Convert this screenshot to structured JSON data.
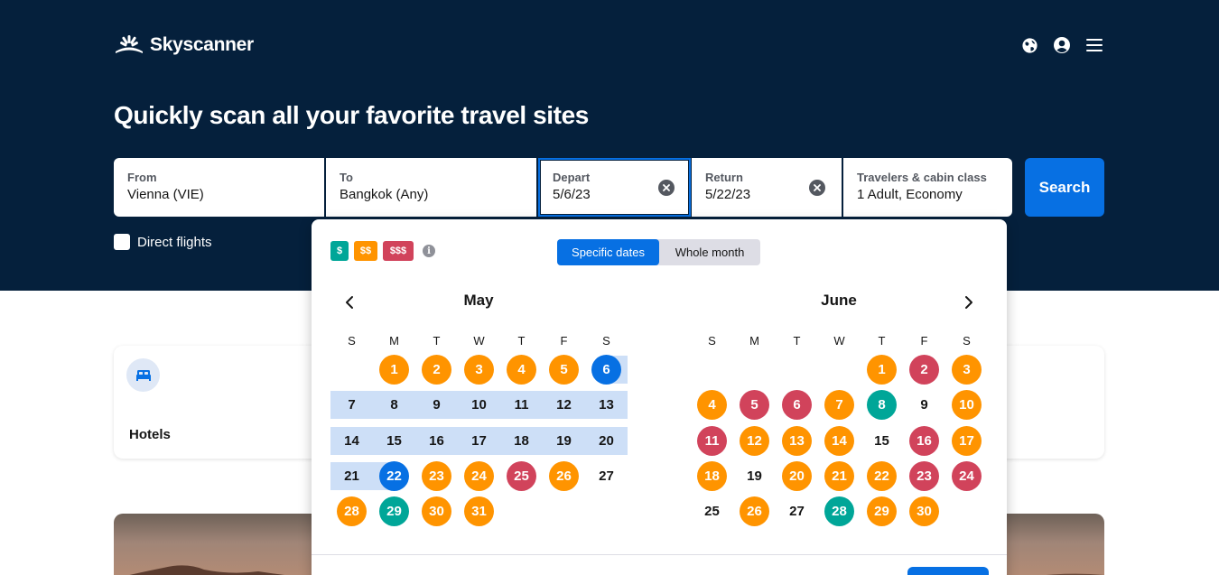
{
  "brand": {
    "name": "Skyscanner"
  },
  "header": {
    "icons": [
      "globe-icon",
      "account-icon",
      "menu-icon"
    ]
  },
  "hero": {
    "headline": "Quickly scan all your favorite travel sites"
  },
  "search": {
    "from": {
      "label": "From",
      "value": "Vienna (VIE)"
    },
    "to": {
      "label": "To",
      "value": "Bangkok (Any)"
    },
    "depart": {
      "label": "Depart",
      "value": "5/6/23"
    },
    "return": {
      "label": "Return",
      "value": "5/22/23"
    },
    "travelers": {
      "label": "Travelers & cabin class",
      "value": "1 Adult, Economy"
    },
    "button": "Search",
    "direct_flights": "Direct flights"
  },
  "calendar": {
    "price_tags": {
      "low": "$",
      "mid": "$$",
      "high": "$$$"
    },
    "toggle": {
      "specific": "Specific dates",
      "whole": "Whole month"
    },
    "weekdays": [
      "S",
      "M",
      "T",
      "W",
      "T",
      "F",
      "S"
    ],
    "months": [
      {
        "name": "May",
        "weeks": [
          [
            null,
            {
              "d": "1",
              "p": "mid"
            },
            {
              "d": "2",
              "p": "mid"
            },
            {
              "d": "3",
              "p": "mid"
            },
            {
              "d": "4",
              "p": "mid"
            },
            {
              "d": "5",
              "p": "mid"
            },
            {
              "d": "6",
              "p": "sel"
            }
          ],
          [
            {
              "d": "7",
              "p": "range"
            },
            {
              "d": "8",
              "p": "range"
            },
            {
              "d": "9",
              "p": "range"
            },
            {
              "d": "10",
              "p": "range"
            },
            {
              "d": "11",
              "p": "range"
            },
            {
              "d": "12",
              "p": "range"
            },
            {
              "d": "13",
              "p": "range"
            }
          ],
          [
            {
              "d": "14",
              "p": "range"
            },
            {
              "d": "15",
              "p": "range"
            },
            {
              "d": "16",
              "p": "range"
            },
            {
              "d": "17",
              "p": "range"
            },
            {
              "d": "18",
              "p": "range"
            },
            {
              "d": "19",
              "p": "range"
            },
            {
              "d": "20",
              "p": "range"
            }
          ],
          [
            {
              "d": "21",
              "p": "range"
            },
            {
              "d": "22",
              "p": "sel"
            },
            {
              "d": "23",
              "p": "mid"
            },
            {
              "d": "24",
              "p": "mid"
            },
            {
              "d": "25",
              "p": "high"
            },
            {
              "d": "26",
              "p": "mid"
            },
            {
              "d": "27",
              "p": "none"
            }
          ],
          [
            {
              "d": "28",
              "p": "mid"
            },
            {
              "d": "29",
              "p": "low"
            },
            {
              "d": "30",
              "p": "mid"
            },
            {
              "d": "31",
              "p": "mid"
            },
            null,
            null,
            null
          ]
        ]
      },
      {
        "name": "June",
        "weeks": [
          [
            null,
            null,
            null,
            null,
            {
              "d": "1",
              "p": "mid"
            },
            {
              "d": "2",
              "p": "high"
            },
            {
              "d": "3",
              "p": "mid"
            }
          ],
          [
            {
              "d": "4",
              "p": "mid"
            },
            {
              "d": "5",
              "p": "high"
            },
            {
              "d": "6",
              "p": "high"
            },
            {
              "d": "7",
              "p": "mid"
            },
            {
              "d": "8",
              "p": "low"
            },
            {
              "d": "9",
              "p": "none"
            },
            {
              "d": "10",
              "p": "mid"
            }
          ],
          [
            {
              "d": "11",
              "p": "high"
            },
            {
              "d": "12",
              "p": "mid"
            },
            {
              "d": "13",
              "p": "mid"
            },
            {
              "d": "14",
              "p": "mid"
            },
            {
              "d": "15",
              "p": "none"
            },
            {
              "d": "16",
              "p": "high"
            },
            {
              "d": "17",
              "p": "mid"
            }
          ],
          [
            {
              "d": "18",
              "p": "mid"
            },
            {
              "d": "19",
              "p": "none"
            },
            {
              "d": "20",
              "p": "mid"
            },
            {
              "d": "21",
              "p": "mid"
            },
            {
              "d": "22",
              "p": "mid"
            },
            {
              "d": "23",
              "p": "high"
            },
            {
              "d": "24",
              "p": "high"
            }
          ],
          [
            {
              "d": "25",
              "p": "none"
            },
            {
              "d": "26",
              "p": "mid"
            },
            {
              "d": "27",
              "p": "none"
            },
            {
              "d": "28",
              "p": "low"
            },
            {
              "d": "29",
              "p": "mid"
            },
            {
              "d": "30",
              "p": "mid"
            },
            null
          ]
        ]
      }
    ]
  },
  "services": {
    "hotels": "Hotels"
  },
  "colors": {
    "navy": "#05203c",
    "primary": "#0770e3",
    "low": "#00a698",
    "mid": "#ff9400",
    "high": "#d1435b",
    "range": "#cddff7"
  }
}
